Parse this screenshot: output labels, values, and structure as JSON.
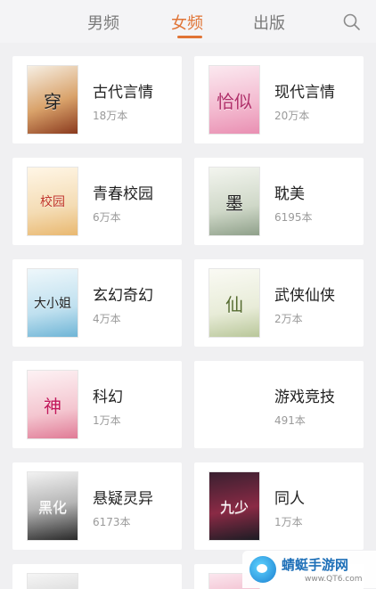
{
  "tabs": [
    {
      "label": "男频"
    },
    {
      "label": "女频"
    },
    {
      "label": "出版"
    }
  ],
  "active_tab": "女频",
  "colors": {
    "accent": "#e07436",
    "background": "#f0f0f2",
    "card": "#ffffff"
  },
  "categories": [
    {
      "name": "古代言情",
      "count": "18万本",
      "cover_title": "穿"
    },
    {
      "name": "现代言情",
      "count": "20万本",
      "cover_title": "恰似"
    },
    {
      "name": "青春校园",
      "count": "6万本",
      "cover_title": "校园"
    },
    {
      "name": "耽美",
      "count": "6195本",
      "cover_title": "墨"
    },
    {
      "name": "玄幻奇幻",
      "count": "4万本",
      "cover_title": "大小姐"
    },
    {
      "name": "武侠仙侠",
      "count": "2万本",
      "cover_title": "仙"
    },
    {
      "name": "科幻",
      "count": "1万本",
      "cover_title": "神"
    },
    {
      "name": "游戏竞技",
      "count": "491本",
      "cover_title": ""
    },
    {
      "name": "悬疑灵异",
      "count": "6173本",
      "cover_title": "黑化"
    },
    {
      "name": "同人",
      "count": "1万本",
      "cover_title": "九少"
    }
  ],
  "watermark": {
    "title": "蜻蜓手游网",
    "url": "www.QT6.com"
  }
}
